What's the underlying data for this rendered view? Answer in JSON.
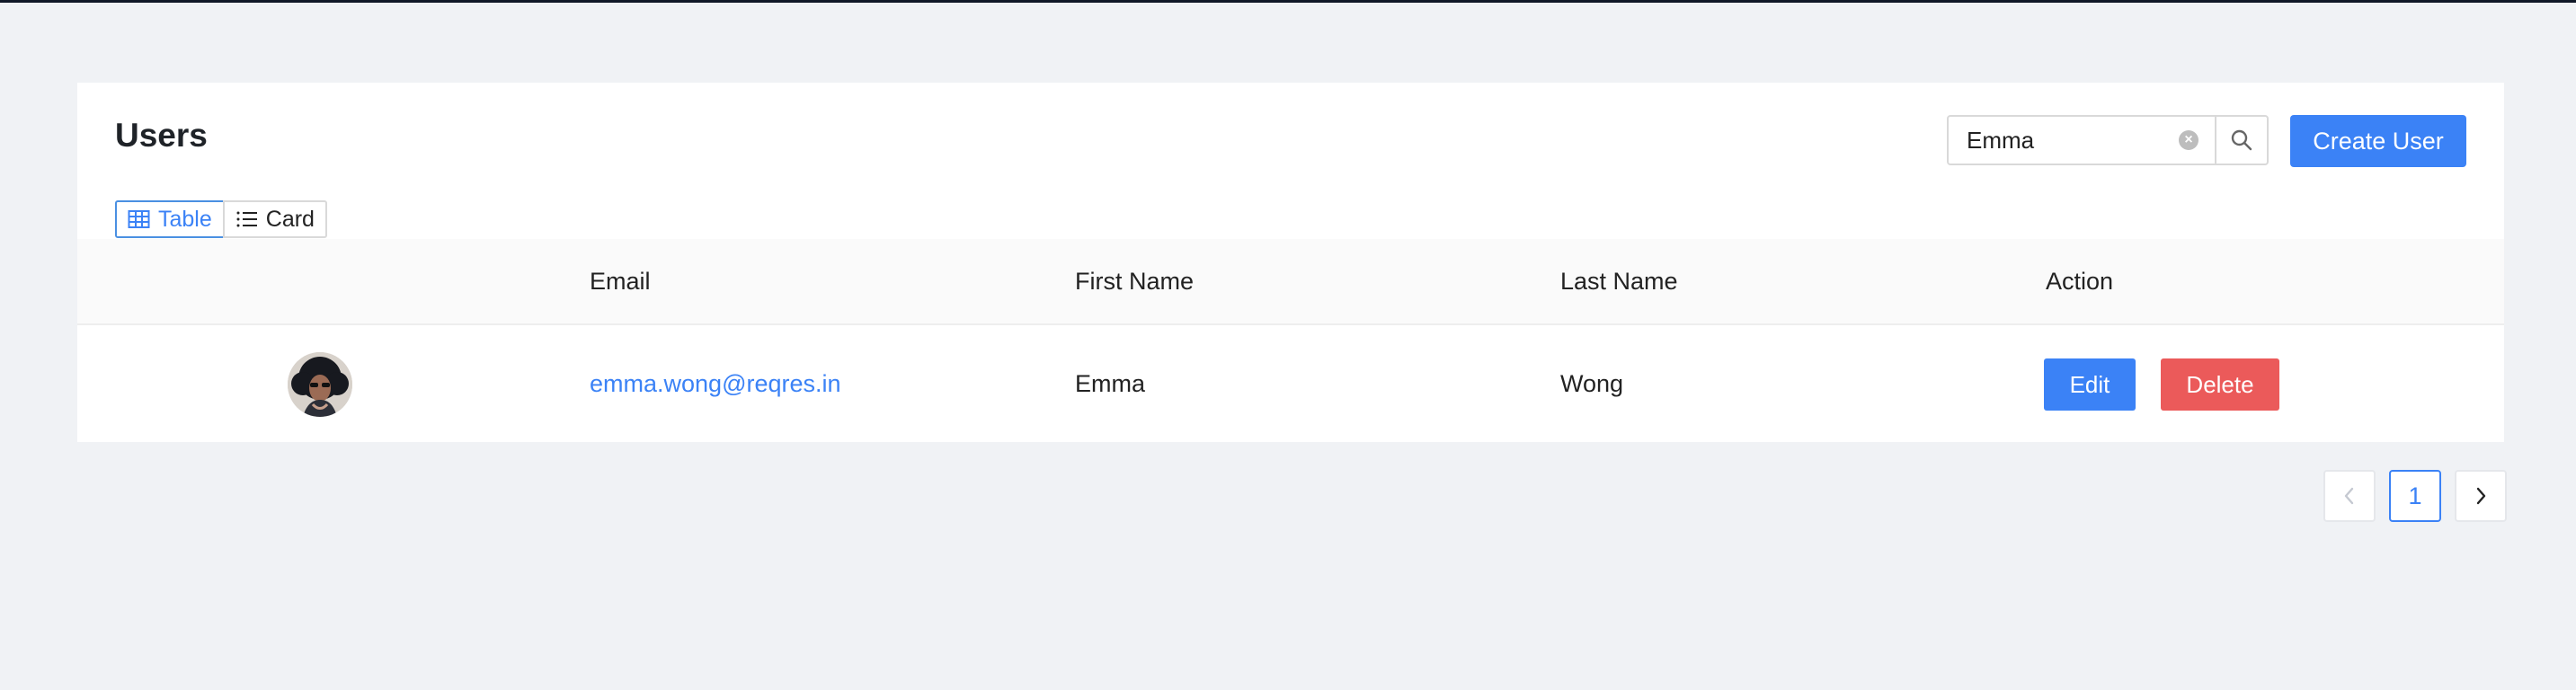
{
  "page": {
    "title": "Users"
  },
  "search": {
    "value": "Emma",
    "clear_icon": "clear-circle-icon",
    "search_icon": "search-icon"
  },
  "actions": {
    "create_user_label": "Create User"
  },
  "view_toggle": {
    "options": [
      {
        "label": "Table",
        "icon": "table-grid-icon",
        "active": true
      },
      {
        "label": "Card",
        "icon": "list-icon",
        "active": false
      }
    ]
  },
  "table": {
    "columns": [
      "",
      "Email",
      "First Name",
      "Last Name",
      "Action"
    ],
    "rows": [
      {
        "avatar": "user-avatar",
        "email": "emma.wong@reqres.in",
        "first_name": "Emma",
        "last_name": "Wong",
        "edit_label": "Edit",
        "delete_label": "Delete"
      }
    ]
  },
  "pagination": {
    "previous_icon": "chevron-left-icon",
    "current_page": "1",
    "next_icon": "chevron-right-icon"
  },
  "colors": {
    "background": "#f0f2f5",
    "card": "#ffffff",
    "primary": "#3b82f6",
    "danger": "#eb5a5a",
    "table_header": "#fafafa"
  }
}
